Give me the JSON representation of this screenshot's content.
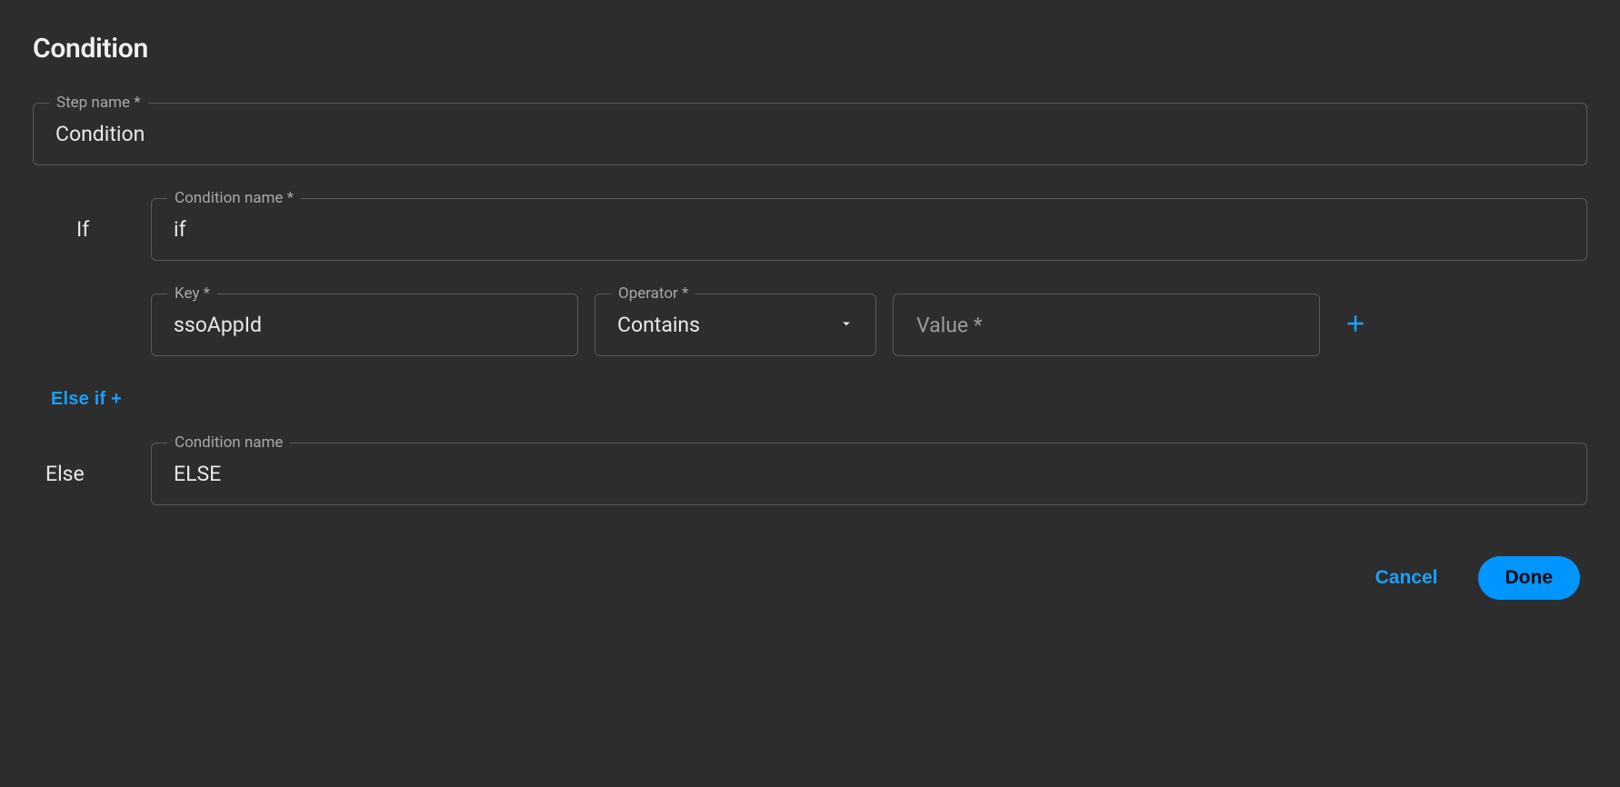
{
  "title": "Condition",
  "step_name": {
    "label": "Step name *",
    "value": "Condition"
  },
  "if_block": {
    "section_label": "If",
    "condition_name": {
      "label": "Condition name *",
      "value": "if"
    },
    "key": {
      "label": "Key *",
      "value": "ssoAppId"
    },
    "operator": {
      "label": "Operator *",
      "value": "Contains"
    },
    "value": {
      "placeholder": "Value *",
      "value": ""
    }
  },
  "elseif_link": "Else if +",
  "else_block": {
    "section_label": "Else",
    "condition_name": {
      "label": "Condition name",
      "value": "ELSE"
    }
  },
  "buttons": {
    "cancel": "Cancel",
    "done": "Done"
  }
}
